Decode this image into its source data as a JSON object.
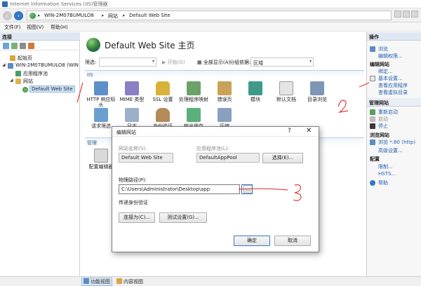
{
  "window": {
    "title": "Internet Information Services (IIS)管理器"
  },
  "address": {
    "crumbs": [
      "WIN-2M07BUMULO8",
      "网站",
      "Default Web Site"
    ]
  },
  "menu": {
    "items": [
      "文件(F)",
      "视图(V)",
      "帮助(H)"
    ]
  },
  "connections": {
    "header": "连接",
    "tree": {
      "start_page": "起始页",
      "server": "WIN-2M07BUMULO8 (WIN",
      "app_pools": "应用程序池",
      "sites": "网站",
      "default_site": "Default Web Site"
    }
  },
  "center": {
    "title": "Default Web Site 主页",
    "filter_label": "筛选:",
    "start_btn": "开始(G)",
    "show_all_btn": "全部显示(A)",
    "group_label": "分组依据:",
    "group_value": "区域",
    "section_iis": "IIS",
    "section_manage": "管理",
    "features_row1": [
      "HTTP 响应标头",
      "MIME 类型",
      "SSL 设置",
      "处理程序映射",
      "错误页",
      "模块",
      "默认文档",
      "目录浏览"
    ],
    "features_row2": [
      "请求筛选",
      "日志",
      "身份验证",
      "输出缓存",
      "压缩"
    ],
    "manage_item": "配置编辑器"
  },
  "actions": {
    "header": "操作",
    "explore": "浏览",
    "edit_permissions": "编辑权限...",
    "edit_site_header": "编辑网站",
    "bindings": "绑定...",
    "basic_settings": "基本设置...",
    "view_apps": "查看应用程序",
    "view_vdirs": "查看虚拟目录",
    "manage_site_header": "管理网站",
    "restart": "重新启动",
    "start": "启动",
    "stop": "停止",
    "browse_site_header": "浏览网站",
    "browse_80": "浏览 *:80 (http)",
    "advanced": "高级设置...",
    "configure_header": "配置",
    "limits": "限制...",
    "hsts": "HSTS...",
    "help": "帮助"
  },
  "status": {
    "features_view": "功能视图",
    "content_view": "内容视图"
  },
  "dialog": {
    "title": "编辑网站",
    "help_glyph": "?",
    "close_glyph": "✕",
    "site_name_label": "网站名称(S):",
    "site_name_value": "Default Web Site",
    "app_pool_label": "应用程序池(L):",
    "app_pool_value": "DefaultAppPool",
    "select_btn": "选择(E)...",
    "physical_path_label": "物理路径(P):",
    "physical_path_value": "C:\\Users\\Administrator\\Desktop\\app",
    "browse_btn": "...",
    "pass_through_label": "传递身份验证",
    "connect_as_btn": "连接为(C)...",
    "test_settings_btn": "测试设置(G)...",
    "ok_btn": "确定",
    "cancel_btn": "取消"
  },
  "annotations": {
    "mark1": "1",
    "mark2": "2",
    "mark3": "3"
  }
}
